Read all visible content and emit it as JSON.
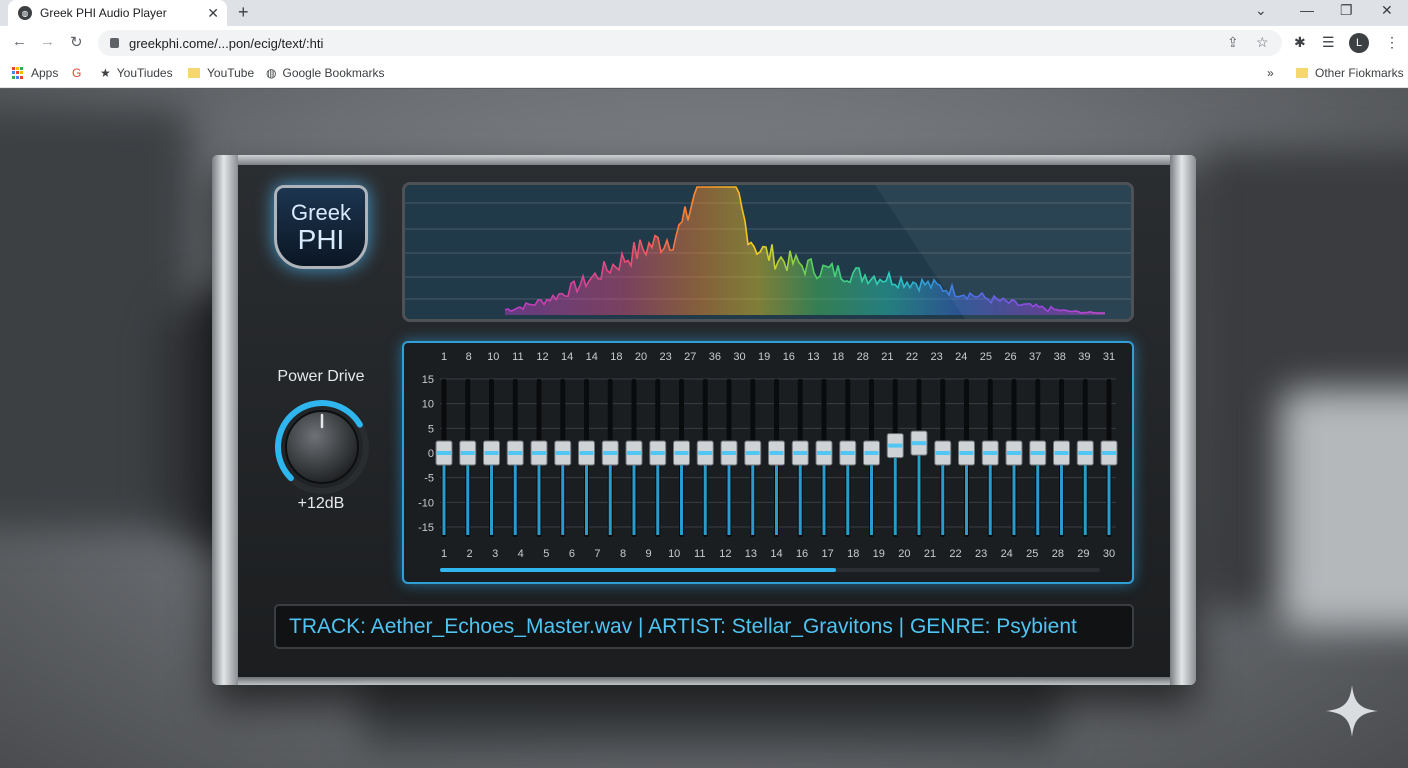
{
  "browser": {
    "tab_title": "Greek PHI Audio Player",
    "url": "greekphi.come/...pon/ecig/text/:hti",
    "profile_initial": "L",
    "bookmarks": {
      "apps": "Apps",
      "item1": "YouTiudes",
      "item2": "YouTube",
      "item3": "Google Bookmarks",
      "more": "»",
      "other": "Other Fiokmarks"
    }
  },
  "player": {
    "logo_line1": "Greek",
    "logo_line2": "PHI",
    "knob_label": "Power Drive",
    "knob_value": "+12dB",
    "knob_level": 0.72,
    "track_info": "TRACK: Aether_Echoes_Master.wav | ARTIST: Stellar_Gravitons | GENRE: Psybient",
    "eq": {
      "top_labels": [
        "1",
        "8",
        "10",
        "11",
        "12",
        "14",
        "14",
        "18",
        "20",
        "23",
        "27",
        "36",
        "30",
        "19",
        "16",
        "13",
        "18",
        "28",
        "21",
        "22",
        "23",
        "24",
        "25",
        "26",
        "37",
        "38",
        "39",
        "31"
      ],
      "bottom_labels": [
        "1",
        "2",
        "3",
        "4",
        "5",
        "6",
        "7",
        "8",
        "9",
        "10",
        "11",
        "12",
        "13",
        "14",
        "16",
        "17",
        "18",
        "19",
        "20",
        "21",
        "22",
        "23",
        "24",
        "25",
        "28",
        "29",
        "30"
      ],
      "scale_labels": [
        "15",
        "10",
        "5",
        "0",
        "-5",
        "-10",
        "-15"
      ],
      "slider_levels_db": [
        0,
        0,
        0,
        0,
        0,
        0,
        0,
        0,
        0,
        0,
        0,
        0,
        0,
        0,
        0,
        0,
        0,
        0,
        0,
        1.5,
        2,
        0,
        0,
        0,
        0,
        0,
        0,
        0,
        0
      ],
      "progress": 0.6
    },
    "colors": {
      "accent": "#2fb6ee",
      "logo_glow": "#50beff",
      "track_text": "#4fc4f2"
    }
  }
}
